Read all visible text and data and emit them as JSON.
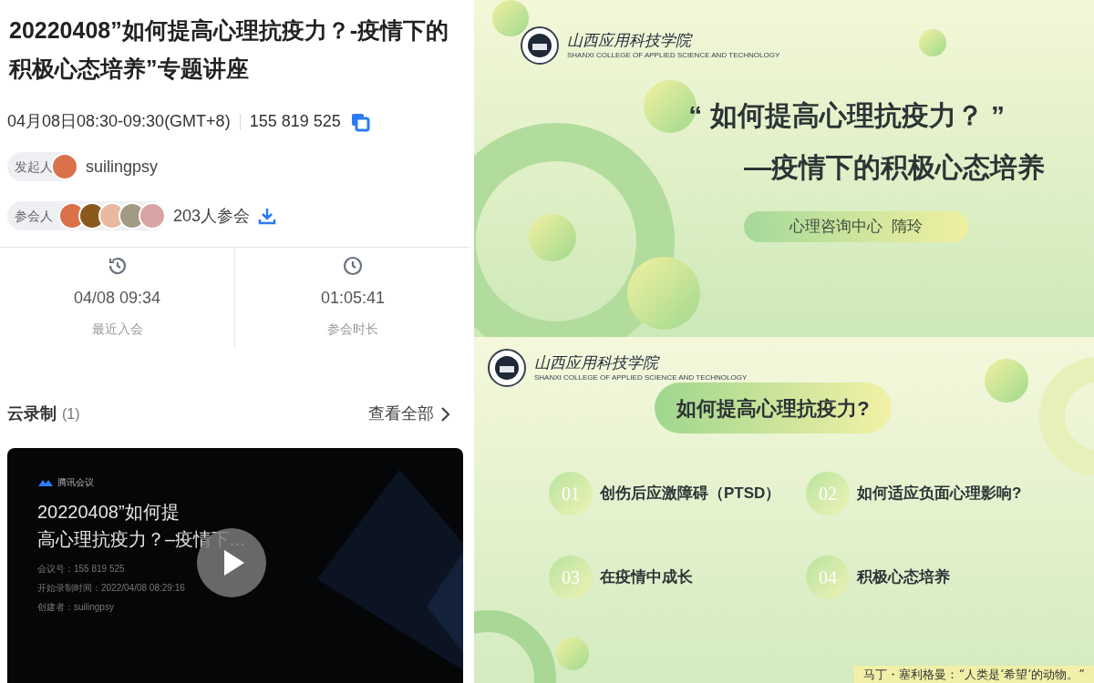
{
  "meeting": {
    "title": "20220408”如何提高心理抗疫力？-疫情下的积极心态培养”专题讲座",
    "time": "04月08日08:30-09:30(GMT+8)",
    "meeting_id": "155 819 525",
    "initiator": {
      "label": "发起人",
      "name": "suilingpsy"
    },
    "participants": {
      "label": "参会人",
      "count": "203人参会"
    },
    "stats": [
      {
        "value": "04/08 09:34",
        "label": "最近入会",
        "kind": "history"
      },
      {
        "value": "01:05:41",
        "label": "参会时长",
        "kind": "clock"
      }
    ]
  },
  "recordings": {
    "title": "云录制",
    "count": "(1)",
    "view_all": "查看全部",
    "video": {
      "brand": "腾讯会议",
      "title_lines": [
        "20220408”如何提",
        "高心理抗疫力？–疫情下..."
      ],
      "details": [
        "会议号：155 819 525",
        "开始录制时间：2022/04/08 08:29:16",
        "创建者：suilingpsy"
      ]
    }
  },
  "slides": [
    {
      "kind": "title",
      "school": {
        "name": "山西应用科技学院",
        "english": "SHANXI COLLEGE OF APPLIED SCIENCE AND TECHNOLOGY"
      },
      "lines": [
        "“ 如何提高心理抗疫力？ ”",
        "—疫情下的积极心态培养"
      ],
      "speaker": "心理咨询中心  隋玲"
    },
    {
      "kind": "agenda",
      "school": {
        "name": "山西应用科技学院",
        "english": "SHANXI COLLEGE OF APPLIED SCIENCE AND TECHNOLOGY"
      },
      "heading": "如何提高心理抗疫力?",
      "items": [
        {
          "number": "01",
          "text": "创伤后应激障碍（PTSD）"
        },
        {
          "number": "02",
          "text": "如何适应负面心理影响?"
        },
        {
          "number": "03",
          "text": "在疫情中成长"
        },
        {
          "number": "04",
          "text": "积极心态培养"
        }
      ],
      "quote": "马丁・塞利格曼：“人类是‘希望’的动物。”"
    }
  ]
}
